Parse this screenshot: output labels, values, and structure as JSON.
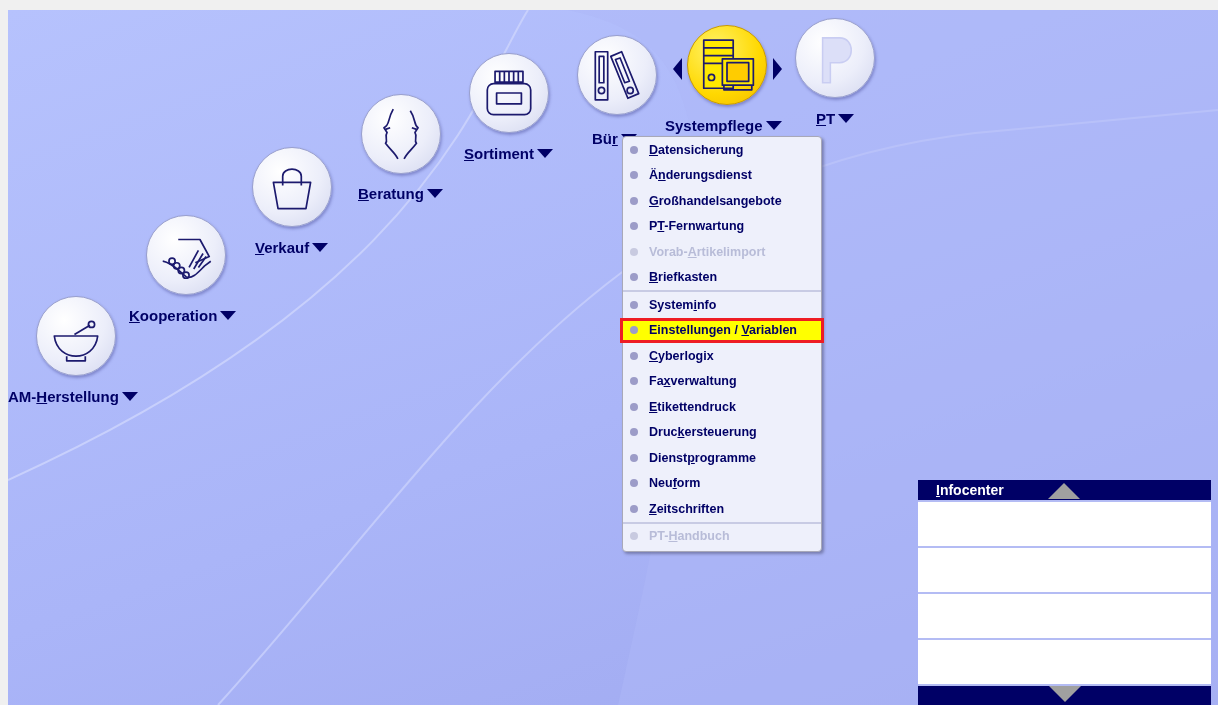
{
  "modules": [
    {
      "label_parts": {
        "pre": "AM-",
        "key": "H",
        "post": "erstellung"
      },
      "selected": false
    },
    {
      "label_parts": {
        "key": "K",
        "post": "ooperation"
      },
      "selected": false
    },
    {
      "label_parts": {
        "key": "V",
        "post": "erkauf"
      },
      "selected": false
    },
    {
      "label_parts": {
        "key": "B",
        "post": "eratung"
      },
      "selected": false
    },
    {
      "label_parts": {
        "key": "S",
        "post": "ortiment"
      },
      "selected": false
    },
    {
      "label_parts": {
        "pre": "Bü",
        "key": "r"
      },
      "selected": false
    },
    {
      "label_parts": {
        "pre": "Systempflege"
      },
      "selected": true
    },
    {
      "label_parts": {
        "key": "P",
        "post": "T"
      },
      "selected": false
    }
  ],
  "menu": {
    "groups": [
      [
        {
          "label_parts": {
            "key": "D",
            "post": "atensicherung"
          },
          "disabled": false,
          "selected": false
        },
        {
          "label_parts": {
            "pre": "Ä",
            "key": "n",
            "post": "derungsdienst"
          },
          "disabled": false,
          "selected": false
        },
        {
          "label_parts": {
            "key": "G",
            "post": "roßhandelsangebote"
          },
          "disabled": false,
          "selected": false
        },
        {
          "label_parts": {
            "pre": "P",
            "key": "T",
            "post": "-Fernwartung"
          },
          "disabled": false,
          "selected": false
        },
        {
          "label_parts": {
            "pre": "Vorab-",
            "key": "A",
            "post": "rtikelimport"
          },
          "disabled": true,
          "selected": false
        },
        {
          "label_parts": {
            "key": "B",
            "post": "riefkasten"
          },
          "disabled": false,
          "selected": false
        }
      ],
      [
        {
          "label_parts": {
            "pre": "System",
            "key": "i",
            "post": "nfo"
          },
          "disabled": false,
          "selected": false
        },
        {
          "label_parts": {
            "pre": "Einstellungen / ",
            "key": "V",
            "post": "ariablen"
          },
          "disabled": false,
          "selected": true
        },
        {
          "label_parts": {
            "key": "C",
            "post": "yberlogix"
          },
          "disabled": false,
          "selected": false
        },
        {
          "label_parts": {
            "pre": "Fa",
            "key": "x",
            "post": "verwaltung"
          },
          "disabled": false,
          "selected": false
        },
        {
          "label_parts": {
            "key": "E",
            "post": "tikettendruck"
          },
          "disabled": false,
          "selected": false
        },
        {
          "label_parts": {
            "pre": "Druc",
            "key": "k",
            "post": "ersteuerung"
          },
          "disabled": false,
          "selected": false
        },
        {
          "label_parts": {
            "pre": "Dienst",
            "key": "p",
            "post": "rogramme"
          },
          "disabled": false,
          "selected": false
        },
        {
          "label_parts": {
            "pre": "Neu",
            "key": "f",
            "post": "orm"
          },
          "disabled": false,
          "selected": false
        },
        {
          "label_parts": {
            "key": "Z",
            "post": "eitschriften"
          },
          "disabled": false,
          "selected": false
        }
      ],
      [
        {
          "label_parts": {
            "pre": "PT-",
            "key": "H",
            "post": "andbuch"
          },
          "disabled": true,
          "selected": false
        }
      ]
    ]
  },
  "infocenter": {
    "title_parts": {
      "key": "I",
      "post": "nfocenter"
    }
  }
}
